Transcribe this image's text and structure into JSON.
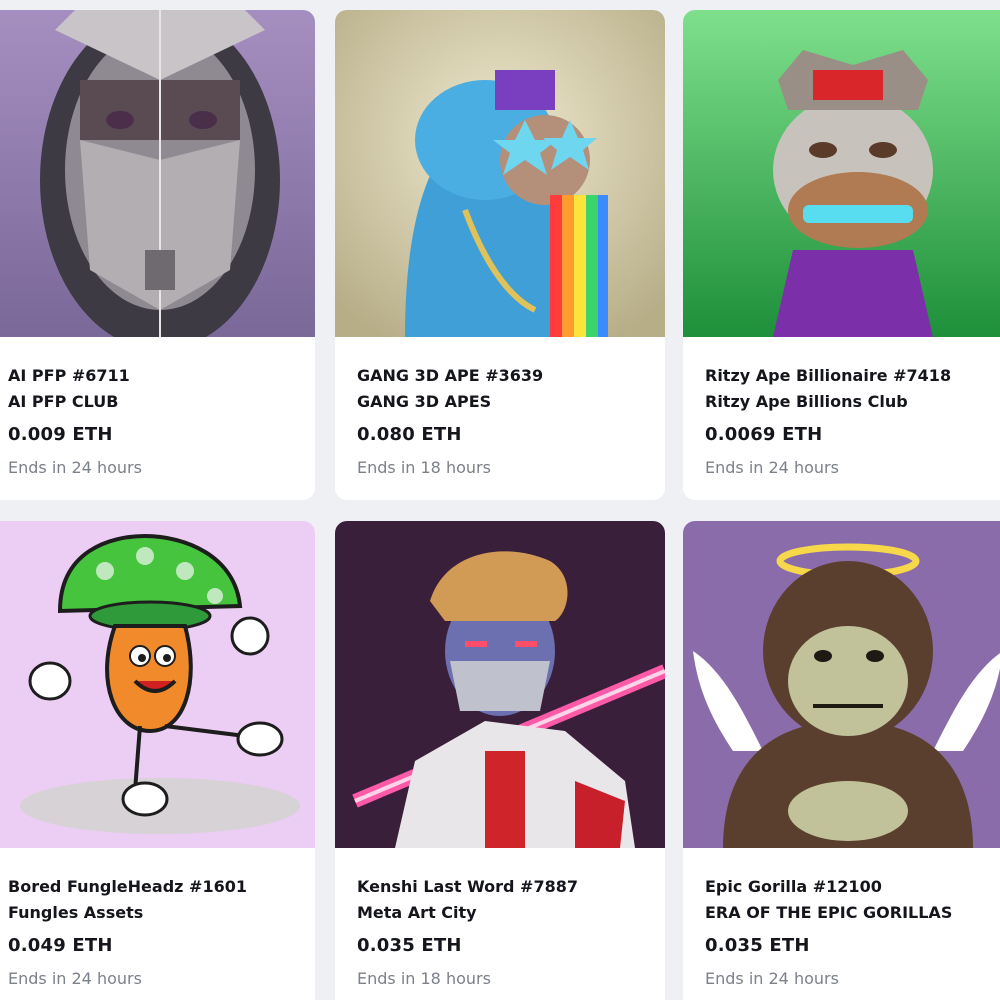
{
  "cards": [
    {
      "name": "AI PFP #6711",
      "collection": "AI PFP CLUB",
      "price": "0.009 ETH",
      "ends": "Ends in 24 hours",
      "art_bg": "#8d7aa8"
    },
    {
      "name": "GANG 3D APE #3639",
      "collection": "GANG 3D APES",
      "price": "0.080 ETH",
      "ends": "Ends in 18 hours",
      "art_bg": "#d9d2b4"
    },
    {
      "name": "Ritzy Ape Billionaire #7418",
      "collection": "Ritzy Ape Billions Club",
      "price": "0.0069 ETH",
      "ends": "Ends in 24 hours",
      "art_bg": "#49c462"
    },
    {
      "name": "Bored FungleHeadz #1601",
      "collection": "Fungles Assets",
      "price": "0.049 ETH",
      "ends": "Ends in 24 hours",
      "art_bg": "#eccdf4"
    },
    {
      "name": "Kenshi Last Word #7887",
      "collection": "Meta Art City",
      "price": "0.035 ETH",
      "ends": "Ends in 18 hours",
      "art_bg": "#3a1f3a"
    },
    {
      "name": "Epic Gorilla #12100",
      "collection": "ERA OF THE EPIC GORILLAS",
      "price": "0.035 ETH",
      "ends": "Ends in 24 hours",
      "art_bg": "#8b6cab"
    }
  ]
}
